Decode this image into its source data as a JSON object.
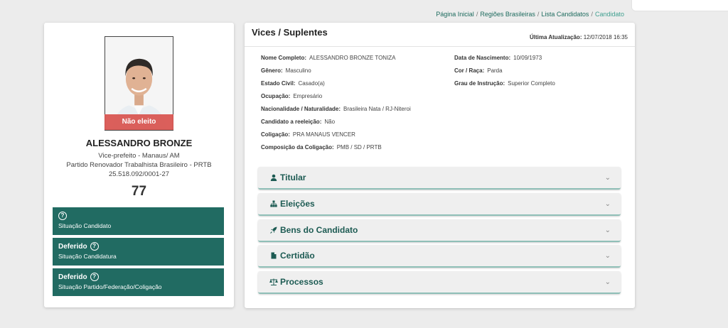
{
  "breadcrumb": [
    "Página Inicial",
    "Regiões Brasileiras",
    "Lista Candidatos",
    "Candidato"
  ],
  "candidate": {
    "badge": "Não eleito",
    "name": "ALESSANDRO BRONZE",
    "office": "Vice-prefeito - Manaus/ AM",
    "party": "Partido Renovador Trabalhista Brasileiro - PRTB",
    "cnpj": "25.518.092/0001-27",
    "number": "77"
  },
  "status": [
    {
      "title": "",
      "sub": "Situação Candidato"
    },
    {
      "title": "Deferido",
      "sub": "Situação Candidatura"
    },
    {
      "title": "Deferido",
      "sub": "Situação Partido/Federação/Coligação"
    }
  ],
  "panel": {
    "title": "Vices / Suplentes",
    "update_label": "Última Atualização:",
    "update_value": "12/07/2018 16:35"
  },
  "details_left": [
    {
      "label": "Nome Completo:",
      "value": "ALESSANDRO BRONZE TONIZA"
    },
    {
      "label": "Gênero:",
      "value": "Masculino"
    },
    {
      "label": "Estado Civil:",
      "value": "Casado(a)"
    },
    {
      "label": "Ocupação:",
      "value": "Empresário"
    },
    {
      "label": "Nacionalidade / Naturalidade:",
      "value": "Brasileira Nata / RJ-Niteroi"
    },
    {
      "label": "Candidato a reeleição:",
      "value": "Não"
    },
    {
      "label": "Coligação:",
      "value": "PRA MANAUS VENCER"
    },
    {
      "label": "Composição da Coligação:",
      "value": "PMB / SD / PRTB"
    }
  ],
  "details_right": [
    {
      "label": "Data de Nascimento:",
      "value": "10/09/1973"
    },
    {
      "label": "Cor / Raça:",
      "value": "Parda"
    },
    {
      "label": "Grau de Instrução:",
      "value": "Superior Completo"
    }
  ],
  "accordion": [
    {
      "label": "Titular",
      "icon": "person-icon"
    },
    {
      "label": "Eleições",
      "icon": "sitemap-icon"
    },
    {
      "label": "Bens do Candidato",
      "icon": "rocket-icon"
    },
    {
      "label": "Certidão",
      "icon": "file-icon"
    },
    {
      "label": "Processos",
      "icon": "scale-icon"
    }
  ],
  "colors": {
    "accent": "#216b62",
    "badge": "#d9534f",
    "link": "#1d6b5e"
  }
}
